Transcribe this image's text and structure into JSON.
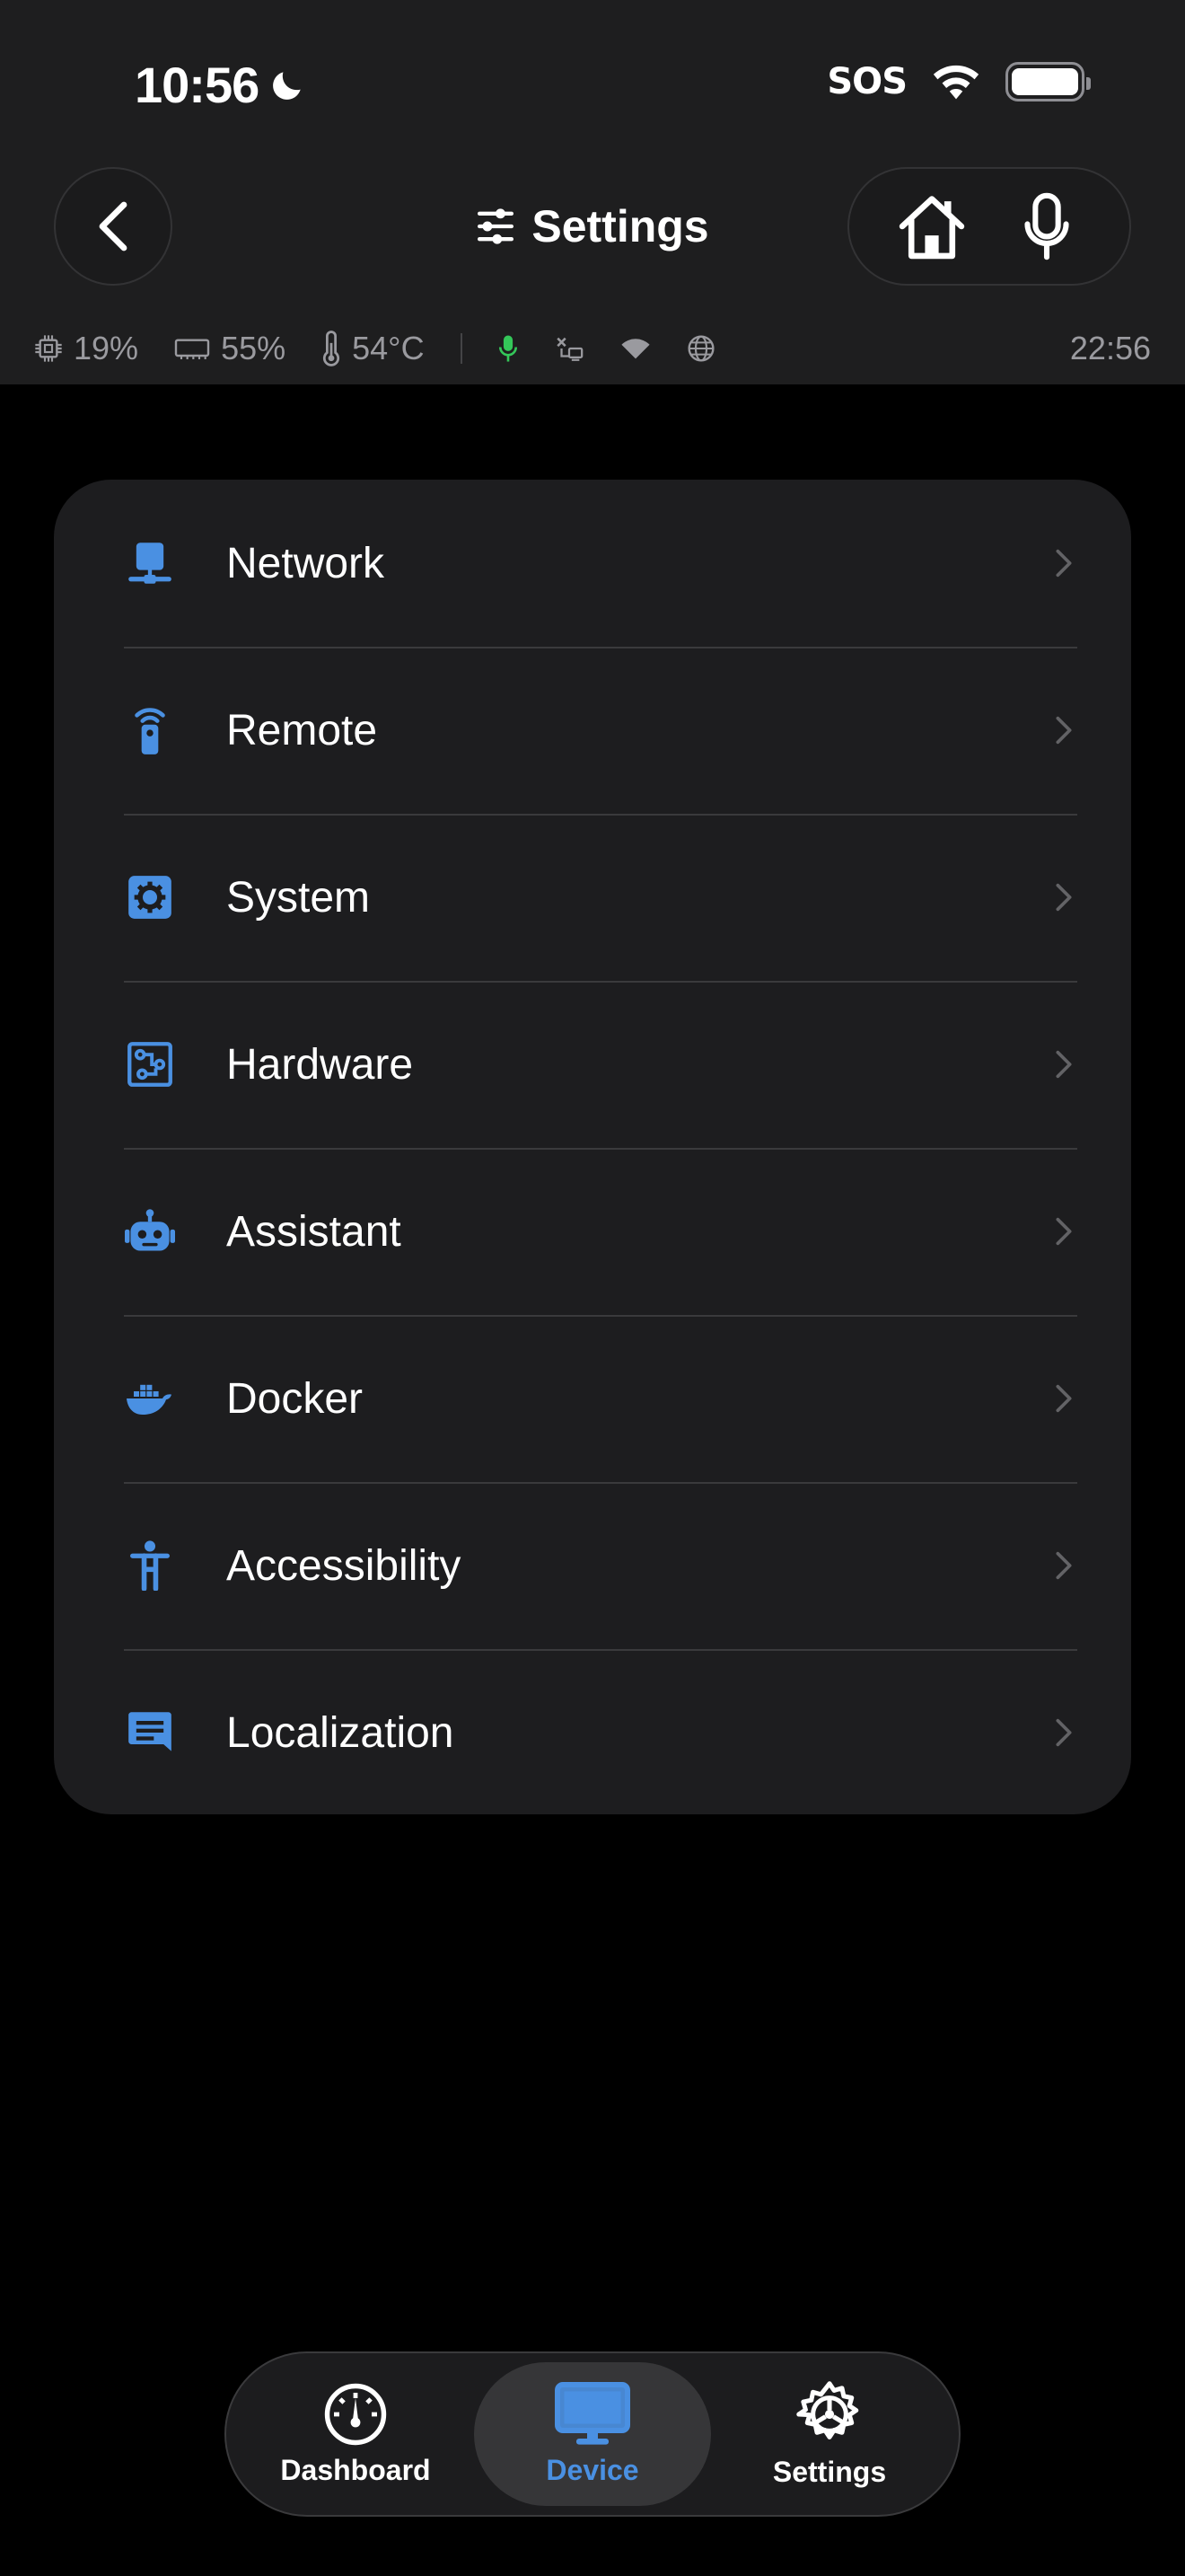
{
  "status_bar": {
    "time": "10:56",
    "carrier": "SOS"
  },
  "header": {
    "title": "Settings"
  },
  "stats": {
    "cpu": "19%",
    "memory": "55%",
    "temperature": "54°C",
    "clock": "22:56"
  },
  "menu": {
    "items": [
      {
        "label": "Network",
        "icon": "network-icon"
      },
      {
        "label": "Remote",
        "icon": "remote-icon"
      },
      {
        "label": "System",
        "icon": "system-icon"
      },
      {
        "label": "Hardware",
        "icon": "hardware-icon"
      },
      {
        "label": "Assistant",
        "icon": "robot-icon"
      },
      {
        "label": "Docker",
        "icon": "docker-icon"
      },
      {
        "label": "Accessibility",
        "icon": "accessibility-icon"
      },
      {
        "label": "Localization",
        "icon": "localization-icon"
      }
    ]
  },
  "tabs": [
    {
      "label": "Dashboard",
      "icon": "gauge-icon",
      "active": false
    },
    {
      "label": "Device",
      "icon": "monitor-icon",
      "active": true
    },
    {
      "label": "Settings",
      "icon": "gear-icon",
      "active": false
    }
  ],
  "colors": {
    "accent": "#4a90e2",
    "mic_status": "#34c759",
    "background": "#000000",
    "surface": "#1d1d1f",
    "header_bg": "#1e1e1f"
  }
}
